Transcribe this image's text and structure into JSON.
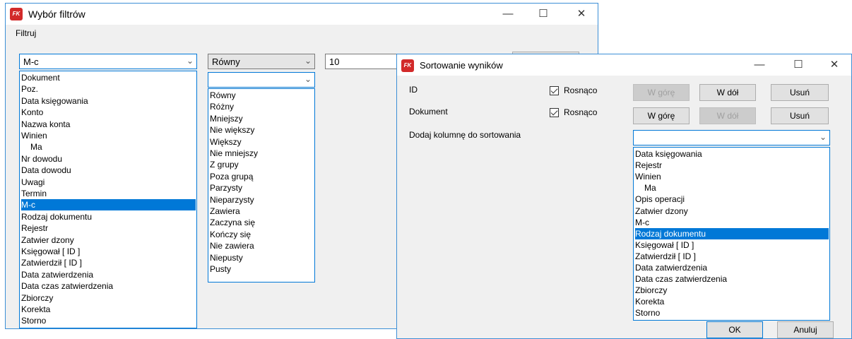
{
  "filters_window": {
    "title": "Wybór filtrów",
    "menu": "Filtruj",
    "field_combo": "M-c",
    "operator_combo": "Równy",
    "operator_combo2": "",
    "value_input": "10",
    "field_options": [
      {
        "label": "Dokument",
        "indent": false,
        "selected": false
      },
      {
        "label": "Poz.",
        "indent": false,
        "selected": false
      },
      {
        "label": "Data księgowania",
        "indent": false,
        "selected": false
      },
      {
        "label": "Konto",
        "indent": false,
        "selected": false
      },
      {
        "label": "Nazwa konta",
        "indent": false,
        "selected": false
      },
      {
        "label": "Winien",
        "indent": false,
        "selected": false
      },
      {
        "label": "Ma",
        "indent": true,
        "selected": false
      },
      {
        "label": "Nr dowodu",
        "indent": false,
        "selected": false
      },
      {
        "label": "Data dowodu",
        "indent": false,
        "selected": false
      },
      {
        "label": "Uwagi",
        "indent": false,
        "selected": false
      },
      {
        "label": "Termin",
        "indent": false,
        "selected": false
      },
      {
        "label": "M-c",
        "indent": false,
        "selected": true
      },
      {
        "label": "Rodzaj dokumentu",
        "indent": false,
        "selected": false
      },
      {
        "label": "Rejestr",
        "indent": false,
        "selected": false
      },
      {
        "label": "Zatwier dzony",
        "indent": false,
        "selected": false
      },
      {
        "label": "Księgował [ ID ]",
        "indent": false,
        "selected": false
      },
      {
        "label": "Zatwierdził [ ID ]",
        "indent": false,
        "selected": false
      },
      {
        "label": "Data zatwierdzenia",
        "indent": false,
        "selected": false
      },
      {
        "label": "Data czas zatwierdzenia",
        "indent": false,
        "selected": false
      },
      {
        "label": "Zbiorczy",
        "indent": false,
        "selected": false
      },
      {
        "label": "Korekta",
        "indent": false,
        "selected": false
      },
      {
        "label": "Storno",
        "indent": false,
        "selected": false
      }
    ],
    "operator_options": [
      "Równy",
      "Różny",
      "Mniejszy",
      "Nie większy",
      "Większy",
      "Nie mniejszy",
      "Z grupy",
      "Poza grupą",
      "Parzysty",
      "Nieparzysty",
      "Zawiera",
      "Zaczyna się",
      "Kończy się",
      "Nie zawiera",
      "Niepusty",
      "Pusty"
    ]
  },
  "sort_window": {
    "title": "Sortowanie wyników",
    "rows": [
      {
        "field": "ID",
        "order": "Rosnąco",
        "up": "W górę",
        "down": "W dół",
        "remove": "Usuń",
        "up_enabled": false,
        "down_enabled": true
      },
      {
        "field": "Dokument",
        "order": "Rosnąco",
        "up": "W górę",
        "down": "W dół",
        "remove": "Usuń",
        "up_enabled": true,
        "down_enabled": false
      }
    ],
    "add_label": "Dodaj kolumnę do sortowania",
    "add_combo": "",
    "add_options": [
      {
        "label": "Data księgowania",
        "indent": false,
        "selected": false
      },
      {
        "label": "Rejestr",
        "indent": false,
        "selected": false
      },
      {
        "label": "Winien",
        "indent": false,
        "selected": false
      },
      {
        "label": "Ma",
        "indent": true,
        "selected": false
      },
      {
        "label": "Opis operacji",
        "indent": false,
        "selected": false
      },
      {
        "label": "Zatwier dzony",
        "indent": false,
        "selected": false
      },
      {
        "label": "M-c",
        "indent": false,
        "selected": false
      },
      {
        "label": "Rodzaj dokumentu",
        "indent": false,
        "selected": true
      },
      {
        "label": "Księgował [ ID ]",
        "indent": false,
        "selected": false
      },
      {
        "label": "Zatwierdził [ ID ]",
        "indent": false,
        "selected": false
      },
      {
        "label": "Data zatwierdzenia",
        "indent": false,
        "selected": false
      },
      {
        "label": "Data czas zatwierdzenia",
        "indent": false,
        "selected": false
      },
      {
        "label": "Zbiorczy",
        "indent": false,
        "selected": false
      },
      {
        "label": "Korekta",
        "indent": false,
        "selected": false
      },
      {
        "label": "Storno",
        "indent": false,
        "selected": false
      }
    ],
    "ok": "OK",
    "cancel": "Anuluj"
  },
  "icons": {
    "minimize": "minimize-icon",
    "maximize": "maximize-icon",
    "close": "close-icon",
    "dropdown": "chevron-down-icon",
    "app": "app-logo-icon"
  },
  "colors": {
    "selection": "#0078d7",
    "window_border": "#3c8fd6",
    "dialog_bg": "#f0f0f0"
  }
}
